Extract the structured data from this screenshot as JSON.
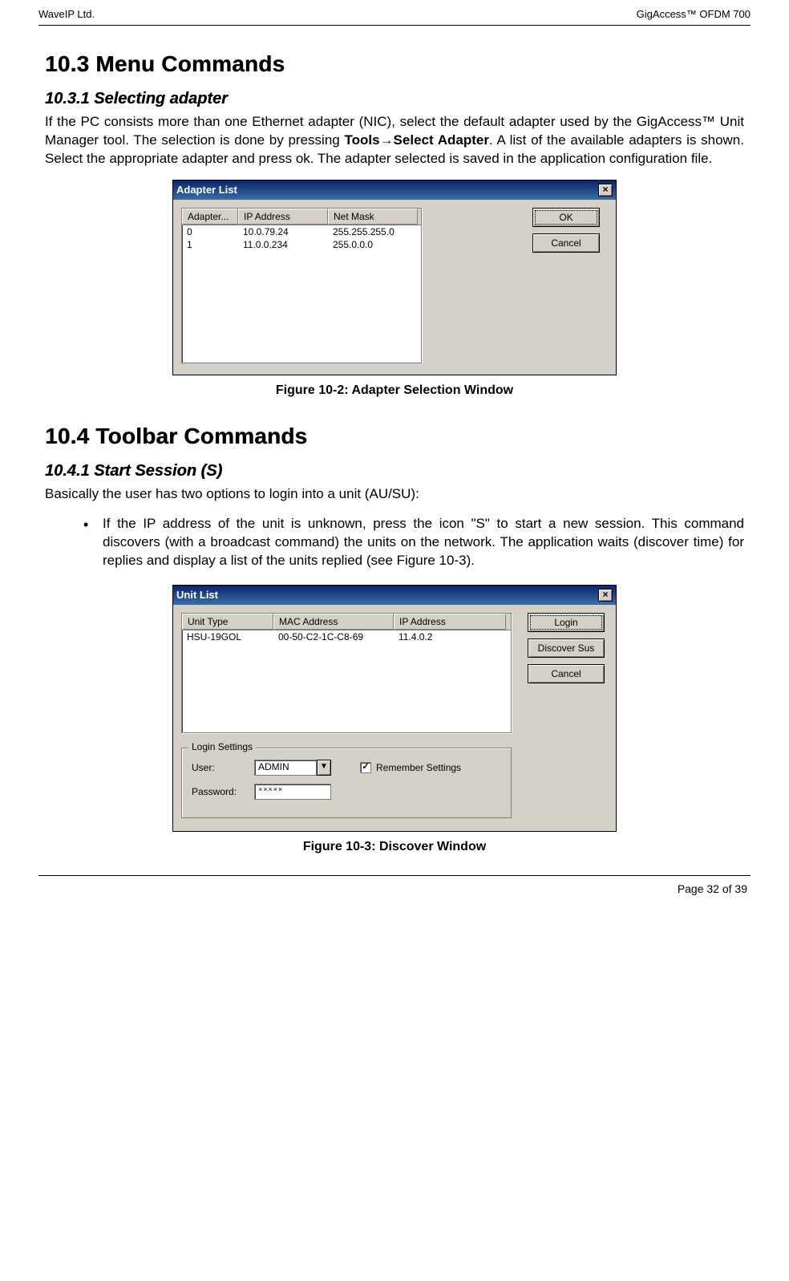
{
  "header": {
    "left": "WaveIP Ltd.",
    "right": "GigAccess™ OFDM 700"
  },
  "footer": {
    "page": "Page 32 of 39"
  },
  "sections": {
    "s103": {
      "heading": "10.3 Menu Commands",
      "sub": "10.3.1 Selecting adapter",
      "para_a": "If the PC consists more than one Ethernet adapter (NIC), select the default adapter used by the GigAccess™ Unit Manager tool. The selection is done by pressing ",
      "tools": "Tools",
      "arrow": "→",
      "select_adapter": "Select Adapter",
      "para_b": ". A list of the available adapters is shown. Select the appropriate adapter and press ok. The adapter selected is saved in the application configuration file."
    },
    "s104": {
      "heading": "10.4 Toolbar Commands",
      "sub": "10.4.1 Start Session (S)",
      "intro": "Basically the user has two options to login into a unit (AU/SU):",
      "bullet": "If the IP address of the unit is unknown, press the icon \"S\" to start a new session. This command discovers (with a broadcast command) the units on the network. The application waits (discover time) for replies and display a list of the units replied (see Figure 10-3)."
    }
  },
  "fig1": {
    "title": "Adapter List",
    "close": "×",
    "cols": {
      "c0": "Adapter...",
      "c1": "IP Address",
      "c2": "Net Mask"
    },
    "rows": [
      {
        "d0": "0",
        "d1": "10.0.79.24",
        "d2": "255.255.255.0"
      },
      {
        "d0": "1",
        "d1": "11.0.0.234",
        "d2": "255.0.0.0"
      }
    ],
    "btn_ok": "OK",
    "btn_cancel": "Cancel",
    "caption": "Figure 10-2: Adapter Selection Window"
  },
  "fig2": {
    "title": "Unit List",
    "close": "×",
    "cols": {
      "u0": "Unit Type",
      "u1": "MAC Address",
      "u2": "IP Address"
    },
    "rows": [
      {
        "u0": "HSU-19GOL",
        "u1": "00-50-C2-1C-C8-69",
        "u2": "11.4.0.2"
      }
    ],
    "btn_login": "Login",
    "btn_discover": "Discover Sus",
    "btn_cancel": "Cancel",
    "login_legend": "Login Settings",
    "user_label": "User:",
    "user_value": "ADMIN",
    "remember": "Remember Settings",
    "pass_label": "Password:",
    "pass_value": "×××××",
    "caption": "Figure 10-3: Discover Window"
  }
}
